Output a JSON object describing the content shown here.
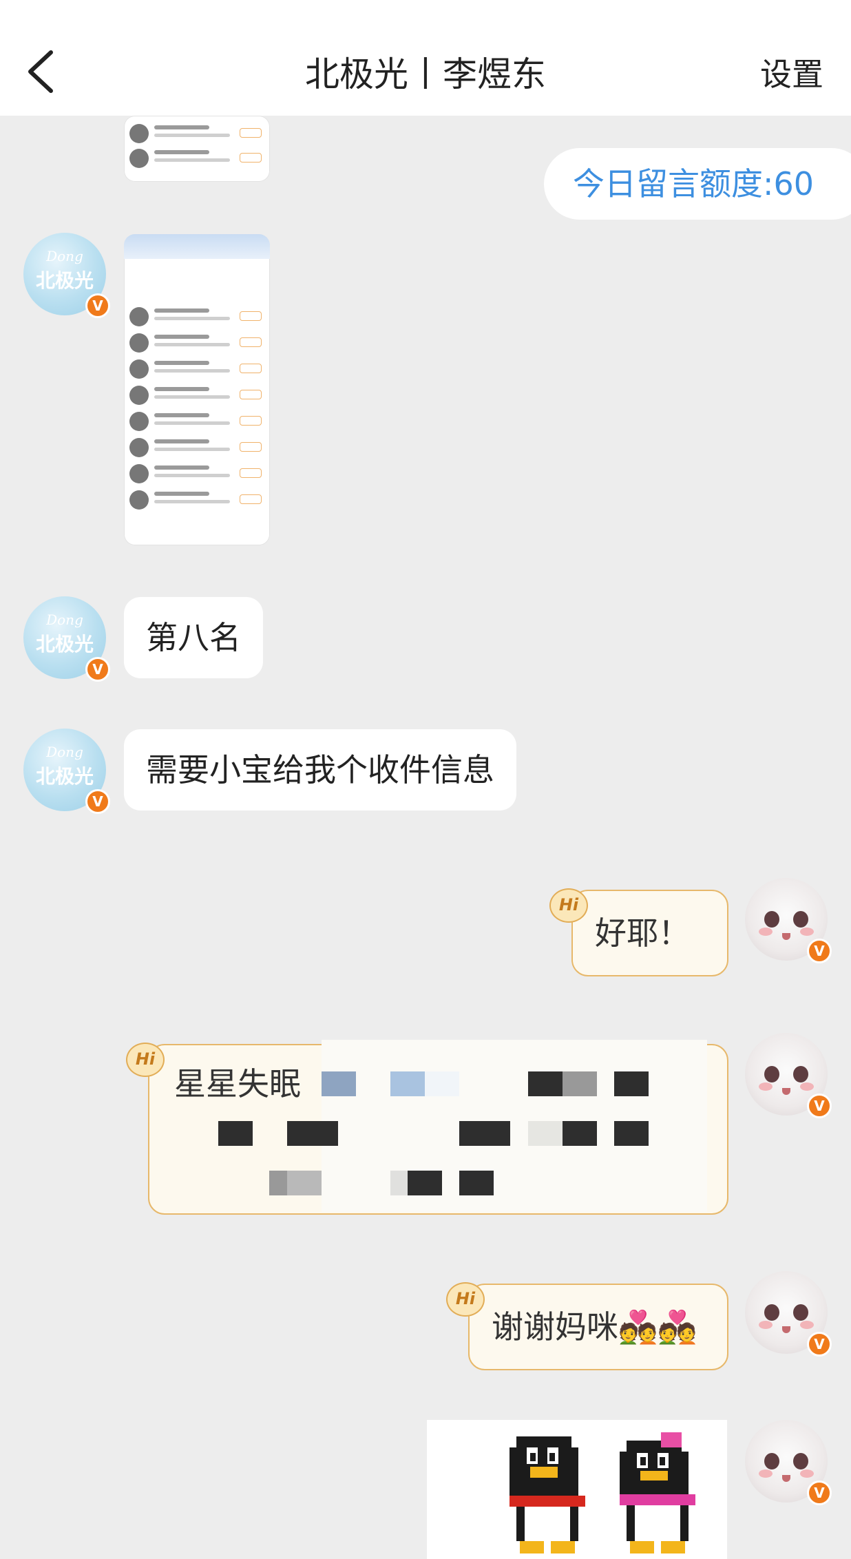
{
  "header": {
    "title": "北极光丨李煜东",
    "settings_label": "设置"
  },
  "quota": "今日留言额度:60",
  "avatar_left": {
    "script_text": "Dong",
    "text": "北极光",
    "badge": "V"
  },
  "avatar_right": {
    "badge": "V"
  },
  "hi_badge_label": "Hi",
  "messages": [
    {
      "side": "left",
      "text": "第八名"
    },
    {
      "side": "left",
      "text": "需要小宝给我个收件信息"
    },
    {
      "side": "right",
      "text": "好耶！"
    },
    {
      "side": "right",
      "text": "星星失眠"
    },
    {
      "side": "right",
      "text": "谢谢妈咪💑💑"
    }
  ],
  "colors": {
    "accent": "#3d8fe0",
    "badge": "#f07a1a",
    "bubble_border": "#e7b86a"
  }
}
